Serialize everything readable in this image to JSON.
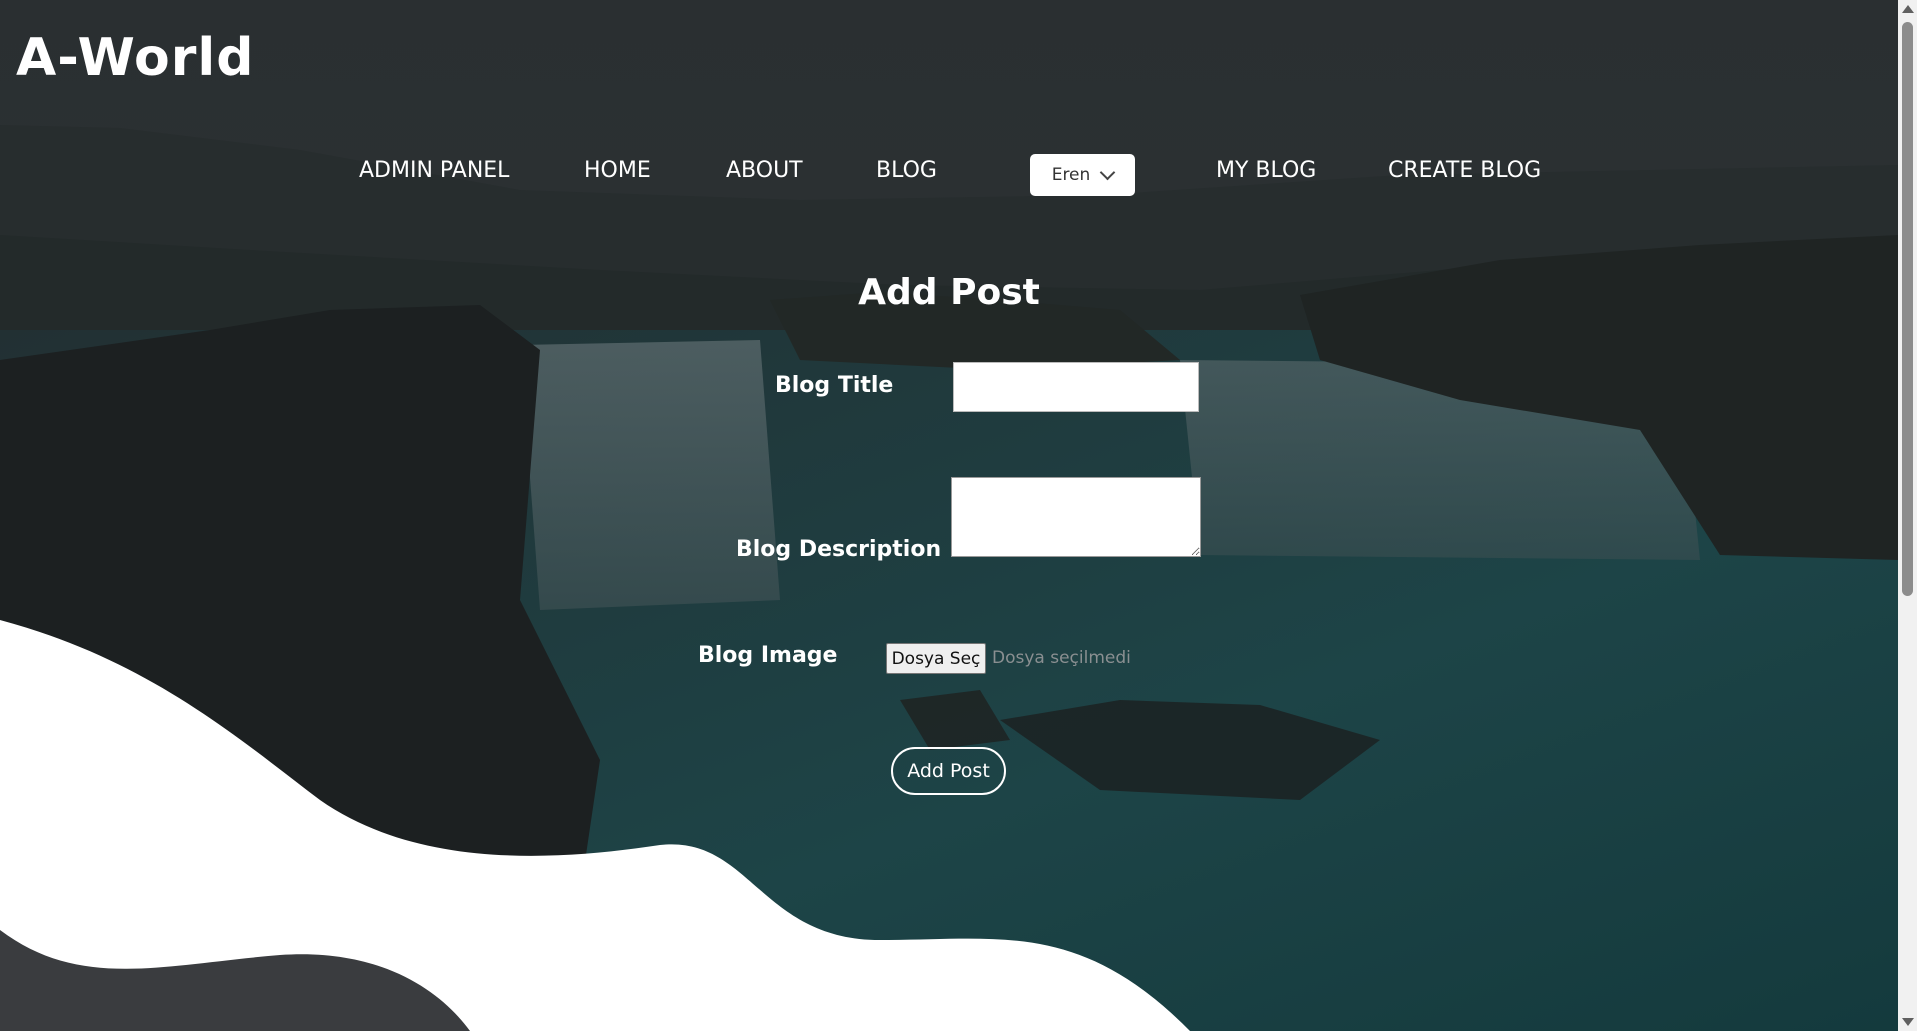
{
  "brand": {
    "logo_text": "A-World"
  },
  "nav": {
    "items": [
      {
        "label": "ADMIN PANEL"
      },
      {
        "label": "HOME"
      },
      {
        "label": "ABOUT"
      },
      {
        "label": "BLOG"
      },
      {
        "label": "MY BLOG"
      },
      {
        "label": "CREATE BLOG"
      }
    ],
    "user_menu": {
      "label": "Eren",
      "icon": "chevron-down-icon"
    }
  },
  "form": {
    "title": "Add Post",
    "blog_title_label": "Blog Title",
    "blog_title_value": "",
    "blog_description_label": "Blog Description",
    "blog_description_value": "",
    "blog_image_label": "Blog Image",
    "file_button_label": "Dosya Seç",
    "file_status": "Dosya seçilmedi",
    "submit_label": "Add Post"
  },
  "colors": {
    "overlay": "#1b2326",
    "wave_white": "#ffffff",
    "wave_dark": "#3a3c3f",
    "text": "#ffffff"
  }
}
